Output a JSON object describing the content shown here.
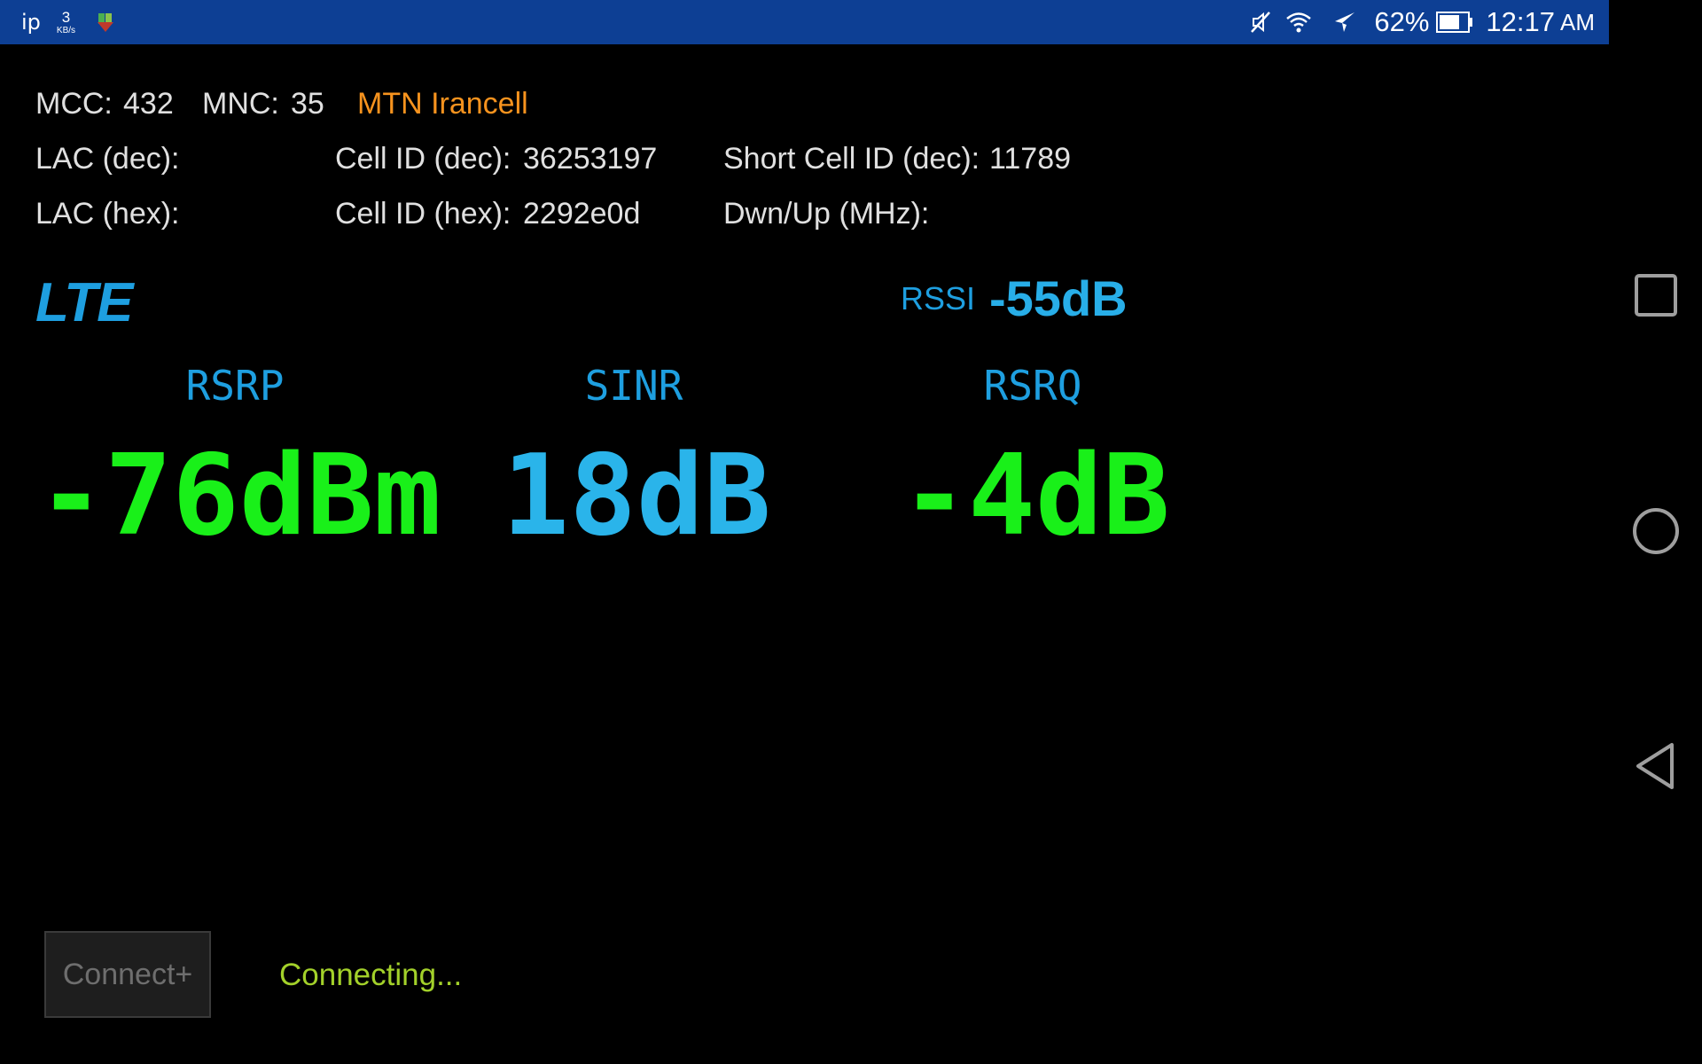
{
  "status_bar": {
    "ip_label": "ip",
    "speed_value": "3",
    "speed_unit": "KB/s",
    "battery_percent": "62%",
    "time": "12:17",
    "ampm": "AM",
    "colors": {
      "background": "#0d3f94"
    },
    "icons": [
      "app-notification-icon",
      "mute-icon",
      "wifi-icon",
      "airplane-icon",
      "battery-icon"
    ]
  },
  "cell_info": {
    "mcc_label": "MCC:",
    "mcc_value": "432",
    "mnc_label": "MNC:",
    "mnc_value": "35",
    "operator": "MTN Irancell",
    "lac_dec_label": "LAC (dec):",
    "lac_hex_label": "LAC (hex):",
    "cellid_dec_label": "Cell ID (dec):",
    "cellid_dec_value": "36253197",
    "cellid_hex_label": "Cell ID (hex):",
    "cellid_hex_value": "2292e0d",
    "short_cellid_label": "Short Cell ID (dec):",
    "short_cellid_value": "11789",
    "dwnup_label": "Dwn/Up (MHz):"
  },
  "signal": {
    "technology": "LTE",
    "rssi_label": "RSSI",
    "rssi_value": "-55dB",
    "metrics": [
      {
        "label": "RSRP",
        "value": "-76dBm",
        "color": "#19f019"
      },
      {
        "label": "SINR",
        "value": "18dB",
        "color": "#2ab4ea"
      },
      {
        "label": "RSRQ",
        "value": "-4dB",
        "color": "#19f019"
      }
    ]
  },
  "footer": {
    "connect_button_label": "Connect+",
    "status_text": "Connecting..."
  },
  "nav_bar": {
    "buttons": [
      "recents-icon",
      "home-icon",
      "back-icon"
    ]
  }
}
